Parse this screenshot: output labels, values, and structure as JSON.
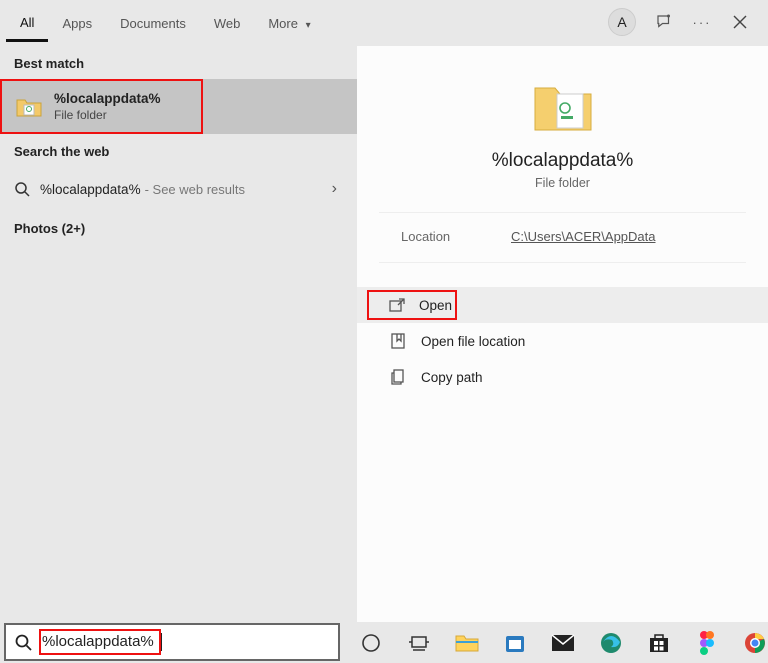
{
  "tabs": {
    "all": "All",
    "apps": "Apps",
    "documents": "Documents",
    "web": "Web",
    "more": "More"
  },
  "user_initial": "A",
  "left": {
    "best_match_header": "Best match",
    "best_title": "%localappdata%",
    "best_sub": "File folder",
    "search_web_header": "Search the web",
    "web_query": "%localappdata%",
    "web_hint": " - See web results",
    "photos_header": "Photos (2+)"
  },
  "preview": {
    "title": "%localappdata%",
    "subtitle": "File folder",
    "location_label": "Location",
    "location_value": "C:\\Users\\ACER\\AppData",
    "actions": {
      "open": "Open",
      "open_loc": "Open file location",
      "copy_path": "Copy path"
    }
  },
  "search_input": "%localappdata%"
}
